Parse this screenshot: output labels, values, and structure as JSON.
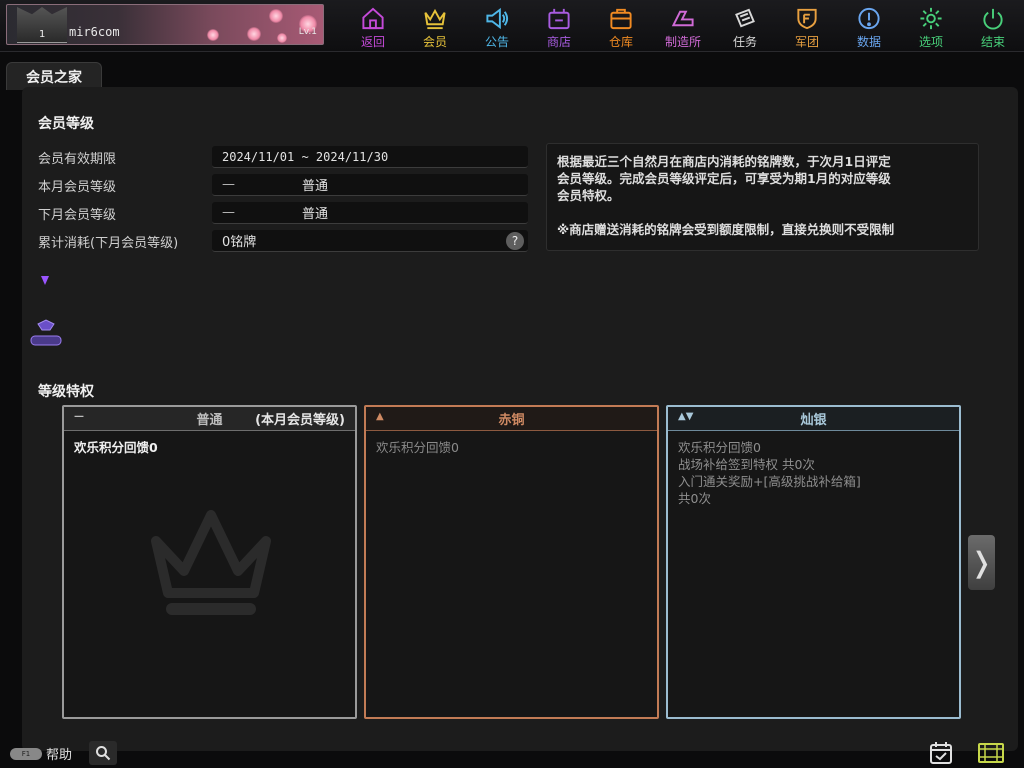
{
  "profile": {
    "name": "mir6com",
    "level_badge": "1",
    "level": "Lv.1"
  },
  "nav": [
    {
      "label": "返回",
      "icon": "home-icon",
      "color": "#c44ad8"
    },
    {
      "label": "会员",
      "icon": "crown-icon",
      "color": "#e6c23a"
    },
    {
      "label": "公告",
      "icon": "megaphone-icon",
      "color": "#4fb7e8"
    },
    {
      "label": "商店",
      "icon": "shop-icon",
      "color": "#a85ce0"
    },
    {
      "label": "仓库",
      "icon": "storage-icon",
      "color": "#f08a22"
    },
    {
      "label": "制造所",
      "icon": "crafting-icon",
      "color": "#d06ad6"
    },
    {
      "label": "任务",
      "icon": "quest-icon",
      "color": "#d8d8d8"
    },
    {
      "label": "军团",
      "icon": "guild-shield-icon",
      "color": "#e8a040"
    },
    {
      "label": "数据",
      "icon": "info-icon",
      "color": "#6aa6f0"
    },
    {
      "label": "选项",
      "icon": "gear-icon",
      "color": "#48d07a"
    },
    {
      "label": "结束",
      "icon": "power-icon",
      "color": "#48d07a"
    }
  ],
  "tab": "会员之家",
  "membership": {
    "title": "会员等级",
    "rows": [
      {
        "label": "会员有效期限",
        "value": "2024/11/01 ~ 2024/11/30"
      },
      {
        "label": "本月会员等级",
        "dash": "—",
        "value": "普通"
      },
      {
        "label": "下月会员等级",
        "dash": "—",
        "value": "普通"
      },
      {
        "label": "累计消耗(下月会员等级)",
        "value": "0铭牌",
        "help": "?"
      }
    ],
    "description": {
      "line1": "根据最近三个自然月在商店内消耗的铭牌数，于次月1日评定",
      "line2": "会员等级。完成会员等级评定后，可享受为期1月的对应等级",
      "line3": "会员特权。",
      "note": "※商店赠送消耗的铭牌会受到额度限制，直接兑换则不受限制"
    }
  },
  "privileges": {
    "title": "等级特权",
    "cards": [
      {
        "icon": "—",
        "name": "普通",
        "current": "(本月会员等级)",
        "lines": [
          "欢乐积分回馈0"
        ]
      },
      {
        "icon": "▲",
        "name": "赤铜",
        "lines": [
          "欢乐积分回馈0"
        ]
      },
      {
        "icon": "▲▼",
        "name": "灿银",
        "lines": [
          "欢乐积分回馈0",
          "战场补给签到特权 共0次",
          "入门通关奖励+[高级挑战补给箱]",
          "共0次"
        ]
      }
    ],
    "next_label": "❭"
  },
  "bottom": {
    "help_label": "帮助",
    "help_key": "F1"
  }
}
